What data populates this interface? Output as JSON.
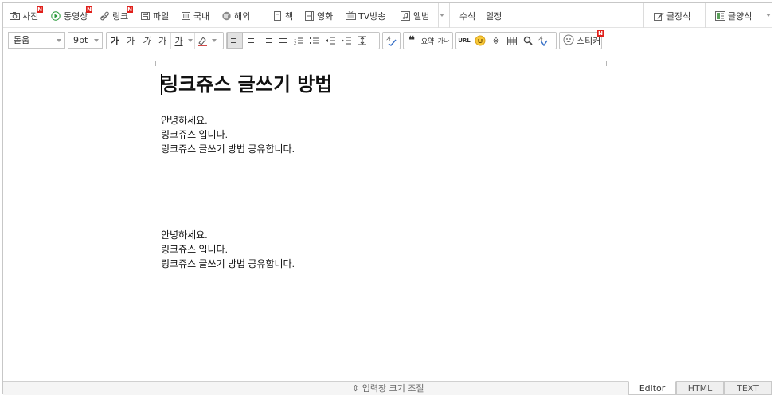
{
  "toolbar_top": {
    "photo": "사진",
    "video": "동영상",
    "link": "링크",
    "file": "파일",
    "domestic": "국내",
    "overseas": "해외",
    "book": "책",
    "movie": "영화",
    "tv": "TV방송",
    "album": "앨범",
    "formula": "수식",
    "schedule": "일정",
    "text_template": "글장식",
    "text_style": "글양식",
    "new_badge": "N"
  },
  "toolbar_format": {
    "font_family": "돋움",
    "font_size": "9pt",
    "bold": "가",
    "underline": "가",
    "italic": "가",
    "strike": "가",
    "font_color": "가",
    "quote": "❝",
    "summary": "요약",
    "summary2": "가나",
    "url": "URL",
    "special_char": "※",
    "sticker": "스티커"
  },
  "document": {
    "title": "링크쥬스 글쓰기 방법",
    "block1": [
      "안녕하세요.",
      "링크쥬스 입니다.",
      "링크쥬스 글쓰기 방법 공유합니다."
    ],
    "block2": [
      "안녕하세요.",
      "링크쥬스 입니다.",
      "링크쥬스 글쓰기 방법 공유합니다."
    ]
  },
  "bottom": {
    "resize_label": "입력창 크기 조절",
    "tabs": [
      "Editor",
      "HTML",
      "TEXT"
    ],
    "active_tab": "Editor"
  },
  "colors": {
    "new_badge": "#e0201b",
    "border": "#c7c7c7",
    "active_button": "#e2e2e2"
  }
}
